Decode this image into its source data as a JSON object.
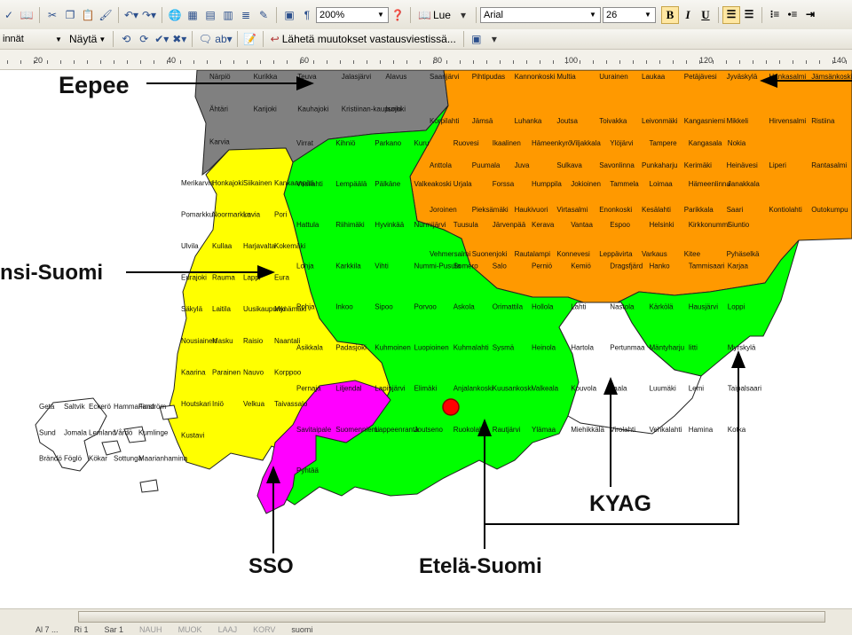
{
  "toolbar1": {
    "zoom": "200%",
    "read_label": "Lue",
    "font_name": "Arial",
    "font_size": "26",
    "bold": "B",
    "italic": "I",
    "underline": "U",
    "pilcrow": "¶"
  },
  "toolbar2": {
    "style": "innät",
    "view_menu": "Näytä",
    "send_changes": "Lähetä muutokset vastausviestissä..."
  },
  "ruler": {
    "labels": [
      "20",
      "40",
      "60",
      "80",
      "100",
      "120",
      "140"
    ]
  },
  "map": {
    "callouts": {
      "eepee": "Eepee",
      "lansi_suomi": "nsi-Suomi",
      "sso": "SSO",
      "etela_suomi": "Etelä-Suomi",
      "kyag": "KYAG"
    },
    "region_colors": {
      "eepee": "#808080",
      "lansi_suomi": "#ffff00",
      "sso": "#ff00ff",
      "etela_suomi": "#00ff00",
      "itae": "#ff9900",
      "kyag": "#ffffff",
      "marker": "#ff0000"
    },
    "place_labels": {
      "top_left": [
        "Närpiö",
        "Kurikka",
        "Teuva",
        "Jalasjärvi",
        "Alavus",
        "Ähtäri",
        "Karijoki",
        "Kauhajoki",
        "Kristiinan-kaupunki",
        "Isojoki",
        "Karvia"
      ],
      "west": [
        "Merikarvia",
        "Honkajoki",
        "Siikainen",
        "Kankaanpää",
        "Pomarkku",
        "Noormarkku",
        "Lavia",
        "Pori",
        "Ulvila",
        "Kullaa",
        "Harjavalta",
        "Kokemäki",
        "Eurajoki",
        "Rauma",
        "Lappi",
        "Eura",
        "Säkylä",
        "Laitila",
        "Uusikaupunki",
        "Mynämäki",
        "Nousiainen",
        "Masku",
        "Raisio",
        "Naantali",
        "Kaarina",
        "Parainen",
        "Nauvo",
        "Korppoo",
        "Houtskari",
        "Iniö",
        "Velkua",
        "Taivassalo",
        "Kustavi"
      ],
      "aland": [
        "Geta",
        "Saltvik",
        "Eckerö",
        "Hammarland",
        "Finström",
        "Sund",
        "Jomala",
        "Lemland",
        "Vårdö",
        "Kumlinge",
        "Brändö",
        "Föglö",
        "Kökar",
        "Sottunga",
        "Maarianhamina"
      ],
      "center": [
        "Virrat",
        "Kihniö",
        "Parkano",
        "Kuru",
        "Ruovesi",
        "Ikaalinen",
        "Hämeenkyrö",
        "Viljakkala",
        "Ylöjärvi",
        "Tampere",
        "Kangasala",
        "Nokia",
        "Vesilahti",
        "Lempäälä",
        "Pälkäne",
        "Valkeakoski",
        "Urjala",
        "Forssa",
        "Humppila",
        "Jokioinen",
        "Tammela",
        "Loimaa",
        "Hämeenlinna",
        "Janakkala",
        "Hattula",
        "Riihimäki",
        "Hyvinkää",
        "Nurmijärvi",
        "Tuusula",
        "Järvenpää",
        "Kerava",
        "Vantaa",
        "Espoo",
        "Helsinki",
        "Kirkkonummi",
        "Siuntio",
        "Lohja",
        "Karkkila",
        "Vihti",
        "Nummi-Pusula",
        "Somero",
        "Salo",
        "Perniö",
        "Kemiö",
        "Dragsfjärd",
        "Hanko",
        "Tammisaari",
        "Karjaa",
        "Pohja",
        "Inkoo",
        "Sipoo",
        "Porvoo",
        "Askola",
        "Orimattila",
        "Hollola",
        "Lahti",
        "Nastola",
        "Kärkölä",
        "Hausjärvi",
        "Loppi",
        "Asikkala",
        "Padasjoki",
        "Kuhmoinen",
        "Luopioinen",
        "Kuhmalahti",
        "Sysmä",
        "Heinola",
        "Hartola",
        "Pertunmaa",
        "Mäntyharju",
        "Iitti",
        "Myrskylä",
        "Pernaja",
        "Liljendal",
        "Lapinjärvi",
        "Elimäki",
        "Anjalankoski",
        "Kuusankoski",
        "Valkeala",
        "Kouvola",
        "Jaala",
        "Luumäki",
        "Lemi",
        "Taipalsaari",
        "Savitaipale",
        "Suomenniemi",
        "Lappeenranta",
        "Joutseno",
        "Ruokolahti",
        "Rautjärvi",
        "Ylämaa",
        "Miehikkälä",
        "Virolahti",
        "Vehkalahti",
        "Hamina",
        "Kotka",
        "Pyhtää"
      ],
      "east": [
        "Saarijärvi",
        "Pihtipudas",
        "Kannonkoski",
        "Multia",
        "Uurainen",
        "Laukaa",
        "Petäjävesi",
        "Jyväskylä",
        "Hankasalmi",
        "Jämsänkoski",
        "Korpilahti",
        "Jämsä",
        "Luhanka",
        "Joutsa",
        "Toivakka",
        "Leivonmäki",
        "Kangasniemi",
        "Mikkeli",
        "Hirvensalmi",
        "Ristiina",
        "Anttola",
        "Puumala",
        "Juva",
        "Sulkava",
        "Savonlinna",
        "Punkaharju",
        "Kerimäki",
        "Heinävesi",
        "Liperi",
        "Rantasalmi",
        "Joroinen",
        "Pieksämäki",
        "Haukivuori",
        "Virtasalmi",
        "Enonkoski",
        "Kesälahti",
        "Parikkala",
        "Saari",
        "Kontiolahti",
        "Outokumpu",
        "Vehmersalmi",
        "Suonenjoki",
        "Rautalampi",
        "Konnevesi",
        "Leppävirta",
        "Varkaus",
        "Kitee",
        "Pyhäselkä"
      ]
    }
  },
  "status": {
    "items": [
      "Al 7 ...",
      "Ri 1",
      "Sar 1",
      "NAUH",
      "MUOK",
      "LAAJ",
      "KORV",
      "suomi"
    ]
  }
}
